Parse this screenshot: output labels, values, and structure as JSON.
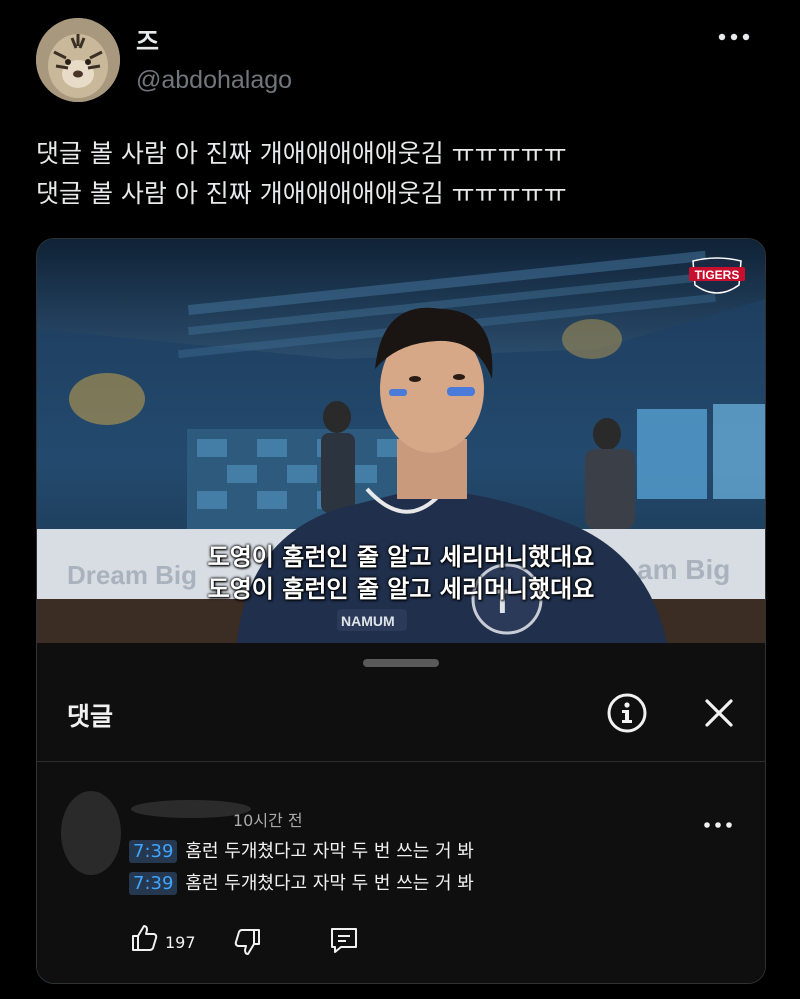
{
  "user": {
    "display_name": "즈",
    "handle": "@abdohalago",
    "avatar_icon": "tiger-avatar-icon"
  },
  "header": {
    "more_icon": "more-horizontal-icon"
  },
  "tweet": {
    "lines": [
      "댓글 볼 사람 아 진짜 개애애애애애웃김 ㅠㅠㅠㅠㅠ",
      "댓글 볼 사람 아 진짜 개애애애애애웃김 ㅠㅠㅠㅠㅠ"
    ]
  },
  "video": {
    "logo_text": "TIGERS",
    "subtitle_lines": [
      "도영이 홈런인 줄 알고 세리머니했대요",
      "도영이 홈런인 줄 알고 세리머니했대요"
    ]
  },
  "comments_panel": {
    "title": "댓글",
    "info_icon": "info-icon",
    "close_icon": "close-icon",
    "comment": {
      "time_ago": "10시간 전",
      "lines": [
        {
          "timestamp": "7:39",
          "text": "홈런 두개쳤다고 자막 두 번 쓰는 거 봐"
        },
        {
          "timestamp": "7:39",
          "text": "홈런 두개쳤다고 자막 두 번 쓰는 거 봐"
        }
      ],
      "like_count": "197"
    }
  },
  "colors": {
    "background": "#000000",
    "sheet_background": "#0f0f0f",
    "timestamp_link": "#3ea6ff",
    "secondary_text": "#71767b"
  }
}
